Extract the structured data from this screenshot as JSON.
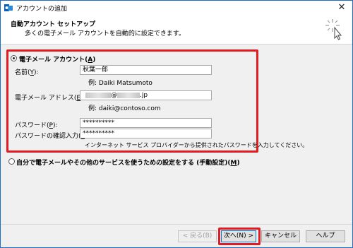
{
  "window": {
    "title": "アカウントの追加",
    "close_glyph": "✕"
  },
  "header": {
    "title": "自動アカウント セットアップ",
    "subtitle": "多くの電子メール アカウントを自動的に設定できます。"
  },
  "email_account": {
    "option_label": "電子メール アカウント(",
    "option_key": "A",
    "option_suffix": ")",
    "selected": true,
    "name_label": "名前(",
    "name_key": "Y",
    "name_suffix": "):",
    "name_value": "秋葉一郎",
    "name_example": "例: Daiki Matsumoto",
    "email_label": "電子メール アドレス(",
    "email_key": "E",
    "email_suffix": "):",
    "email_value_visible": "@",
    "email_value_domain": ".jp",
    "email_example": "例: daiki@contoso.com",
    "password_label": "パスワード(",
    "password_key": "P",
    "password_suffix": "):",
    "password_value": "**********",
    "confirm_label": "パスワードの確認入力(",
    "confirm_key": "T",
    "confirm_suffix": "):",
    "confirm_value": "**********",
    "hint": "インターネット サービス プロバイダーから提供されたパスワードを入力してください。"
  },
  "manual_setup": {
    "option_label": "自分で電子メールやその他のサービスを使うための設定をする (手動設定)(",
    "option_key": "M",
    "option_suffix": ")",
    "selected": false
  },
  "buttons": {
    "back": "< 戻る(B)",
    "next": "次へ(N) >",
    "cancel": "キャンセル",
    "help": "ヘルプ"
  },
  "colors": {
    "highlight": "#e01b22",
    "window_border": "#1e6fc4"
  }
}
